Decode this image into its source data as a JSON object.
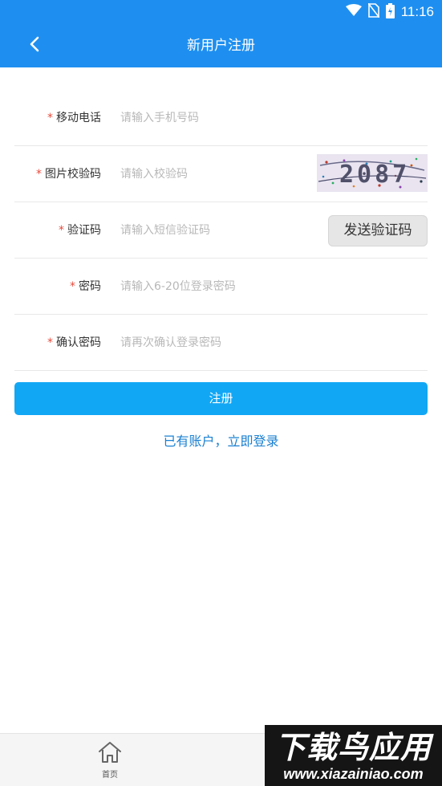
{
  "status_bar": {
    "time": "11:16"
  },
  "header": {
    "title": "新用户注册"
  },
  "form": {
    "rows": [
      {
        "star": "*",
        "label": "移动电话",
        "placeholder": "请输入手机号码",
        "value": ""
      },
      {
        "star": "*",
        "label": "图片校验码",
        "placeholder": "请输入校验码",
        "value": ""
      },
      {
        "star": "*",
        "label": "验证码",
        "placeholder": "请输入短信验证码",
        "value": ""
      },
      {
        "star": "*",
        "label": "密码",
        "placeholder": "请输入6-20位登录密码",
        "value": ""
      },
      {
        "star": "*",
        "label": "确认密码",
        "placeholder": "请再次确认登录密码",
        "value": ""
      }
    ],
    "captcha_text": "2087",
    "sms_button": "发送验证码"
  },
  "register_button": "注册",
  "login_link": "已有账户，立即登录",
  "bottom_nav": {
    "home_label": "首页"
  },
  "watermark": {
    "main": "下载鸟应用",
    "sub": "www.xiazainiao.com"
  },
  "colors": {
    "header": "#1e8ff0",
    "primary_button": "#12a7f5",
    "link": "#1a80d1",
    "required_star": "#e94b3c"
  },
  "icons": [
    "wifi-icon",
    "no-sim-icon",
    "battery-charging-icon",
    "back-arrow-icon",
    "home-icon"
  ]
}
